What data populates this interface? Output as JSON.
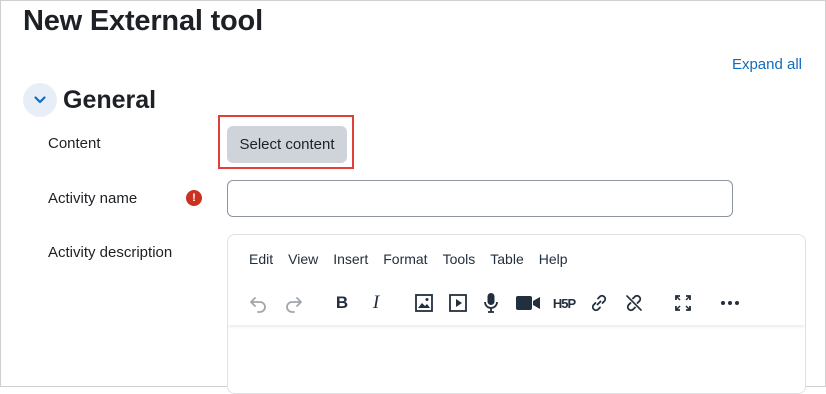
{
  "page": {
    "title": "New External tool"
  },
  "header": {
    "expand_all": "Expand all"
  },
  "section": {
    "title": "General"
  },
  "form": {
    "content_label": "Content",
    "select_content_button": "Select content",
    "activity_name_label": "Activity name",
    "activity_name_value": "",
    "required_mark": "!",
    "activity_description_label": "Activity description"
  },
  "editor": {
    "menu": [
      "Edit",
      "View",
      "Insert",
      "Format",
      "Tools",
      "Table",
      "Help"
    ],
    "toolbar_icons": [
      "undo-icon",
      "redo-icon",
      "bold-icon",
      "italic-icon",
      "image-icon",
      "media-icon",
      "record-audio-icon",
      "record-video-icon",
      "h5p-icon",
      "link-icon",
      "unlink-icon",
      "fullscreen-icon",
      "more-icon"
    ],
    "bold_glyph": "B",
    "italic_glyph": "I",
    "h5p_glyph": "H5P"
  },
  "colors": {
    "accent": "#0f6cbf",
    "required": "#ca3120",
    "highlight_box": "#e0403a",
    "button_bg": "#ced4da"
  }
}
